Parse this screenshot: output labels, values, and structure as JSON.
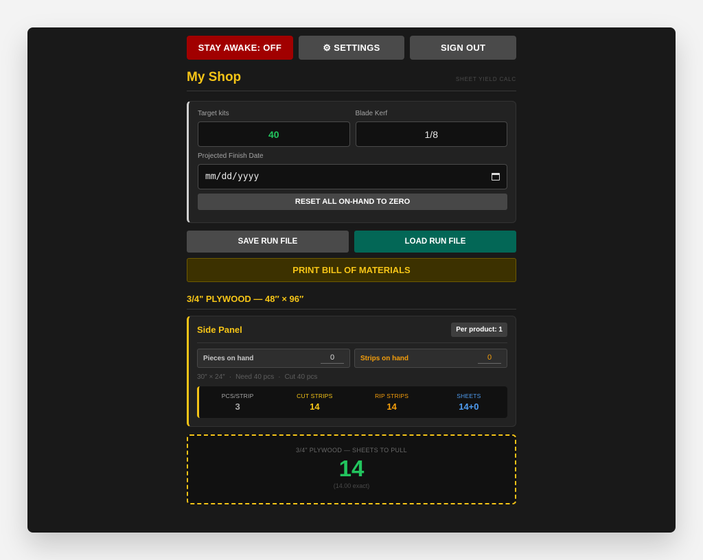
{
  "toolbar": {
    "stay_awake_label": "STAY AWAKE: OFF",
    "settings_icon": "gear-icon",
    "settings_label": "⚙ SETTINGS",
    "sign_out_label": "SIGN OUT"
  },
  "header": {
    "title": "My Shop",
    "subtitle": "SHEET YIELD CALC"
  },
  "settings": {
    "target_kits_label": "Target kits",
    "target_kits_value": "40",
    "blade_kerf_label": "Blade Kerf",
    "blade_kerf_value": "1/8",
    "finish_date_label": "Projected Finish Date",
    "finish_date_placeholder": "mm/dd/yyyy",
    "reset_label": "RESET ALL ON-HAND TO ZERO"
  },
  "run_file": {
    "save_label": "SAVE RUN FILE",
    "load_label": "LOAD RUN FILE"
  },
  "print_label": "PRINT BILL OF MATERIALS",
  "material": {
    "title": "3/4\" PLYWOOD — 48″ × 96″",
    "part": {
      "name": "Side Panel",
      "per_product": "Per product: 1",
      "pieces_label": "Pieces on hand",
      "pieces_value": "0",
      "strips_label": "Strips on hand",
      "strips_value": "0",
      "size": "30″ × 24″",
      "sep": "·",
      "need": "Need 40 pcs",
      "cut": "Cut 40 pcs",
      "stats": [
        {
          "label": "PCS/STRIP",
          "value": "3",
          "color": "#a8a8a8"
        },
        {
          "label": "CUT STRIPS",
          "value": "14",
          "color": "#f5c417"
        },
        {
          "label": "RIP STRIPS",
          "value": "14",
          "color": "#f59e0b"
        },
        {
          "label": "SHEETS",
          "value": "14+0",
          "color": "#4f9cf0"
        }
      ]
    },
    "summary": {
      "label": "3/4\" PLYWOOD — SHEETS TO PULL",
      "value": "14",
      "exact": "(14.00 exact)"
    }
  },
  "colors": {
    "accent": "#f5c417",
    "green": "#22c55e",
    "danger": "#a10000",
    "teal": "#036756"
  }
}
